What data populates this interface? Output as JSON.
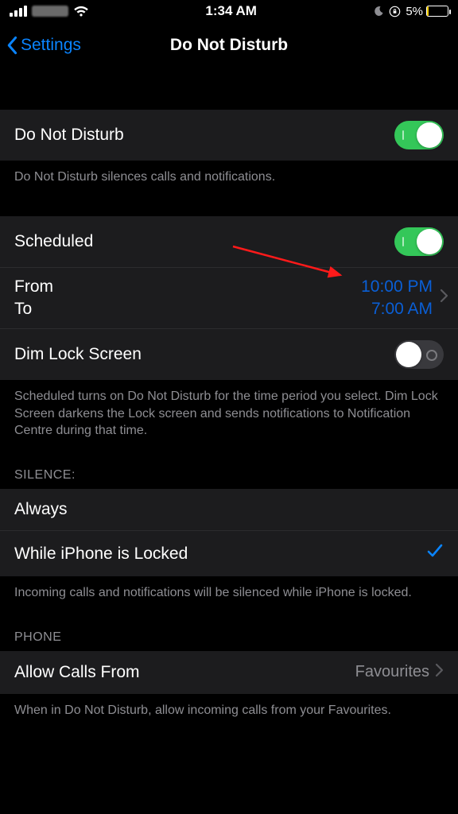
{
  "statusBar": {
    "time": "1:34 AM",
    "batteryPercent": "5%"
  },
  "nav": {
    "back": "Settings",
    "title": "Do Not Disturb"
  },
  "dnd": {
    "label": "Do Not Disturb",
    "footer": "Do Not Disturb silences calls and notifications."
  },
  "scheduled": {
    "label": "Scheduled",
    "fromLabel": "From",
    "toLabel": "To",
    "fromValue": "10:00 PM",
    "toValue": "7:00 AM",
    "dimLabel": "Dim Lock Screen",
    "footer": "Scheduled turns on Do Not Disturb for the time period you select. Dim Lock Screen darkens the Lock screen and sends notifications to Notification Centre during that time."
  },
  "silence": {
    "header": "SILENCE:",
    "always": "Always",
    "whileLocked": "While iPhone is Locked",
    "footer": "Incoming calls and notifications will be silenced while iPhone is locked."
  },
  "phone": {
    "header": "PHONE",
    "allowLabel": "Allow Calls From",
    "allowValue": "Favourites",
    "footer": "When in Do Not Disturb, allow incoming calls from your Favourites."
  }
}
